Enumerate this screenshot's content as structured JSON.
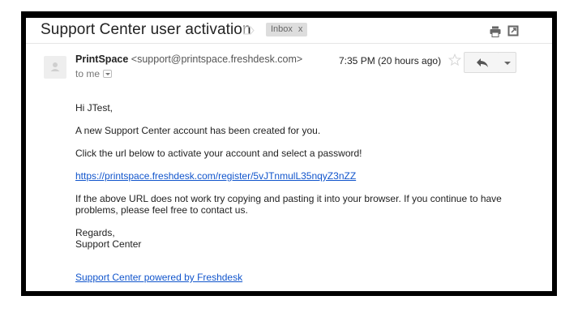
{
  "email": {
    "subject": "Support Center user activation",
    "labels": [
      {
        "text": "Inbox",
        "remove": "x"
      }
    ],
    "sender_name": "PrintSpace",
    "sender_email": "<support@printspace.freshdesk.com>",
    "recipient": "to me",
    "timestamp": "7:35 PM (20 hours ago)",
    "body": {
      "greeting": "Hi JTest,",
      "line1": "A new Support Center account has been created for you.",
      "line2": "Click the url below to activate your account and select a password!",
      "link": "https://printspace.freshdesk.com/register/5vJTnmulL35nqyZ3nZZ",
      "line3": "If the above URL does not work try copying and pasting it into your browser. If you continue to have problems, please feel free to contact us.",
      "regards": "Regards,",
      "signoff": "Support Center",
      "footer_link": "Support Center powered by Freshdesk"
    }
  },
  "icons": {
    "label_tag": "label-tag-icon",
    "print": "print-icon",
    "new_window": "new-window-icon",
    "star": "star-icon",
    "reply": "reply-icon",
    "more": "chevron-down-icon",
    "avatar": "person-icon"
  },
  "colors": {
    "link": "#1155cc",
    "label_bg": "#dddddd",
    "frame": "#000000"
  }
}
